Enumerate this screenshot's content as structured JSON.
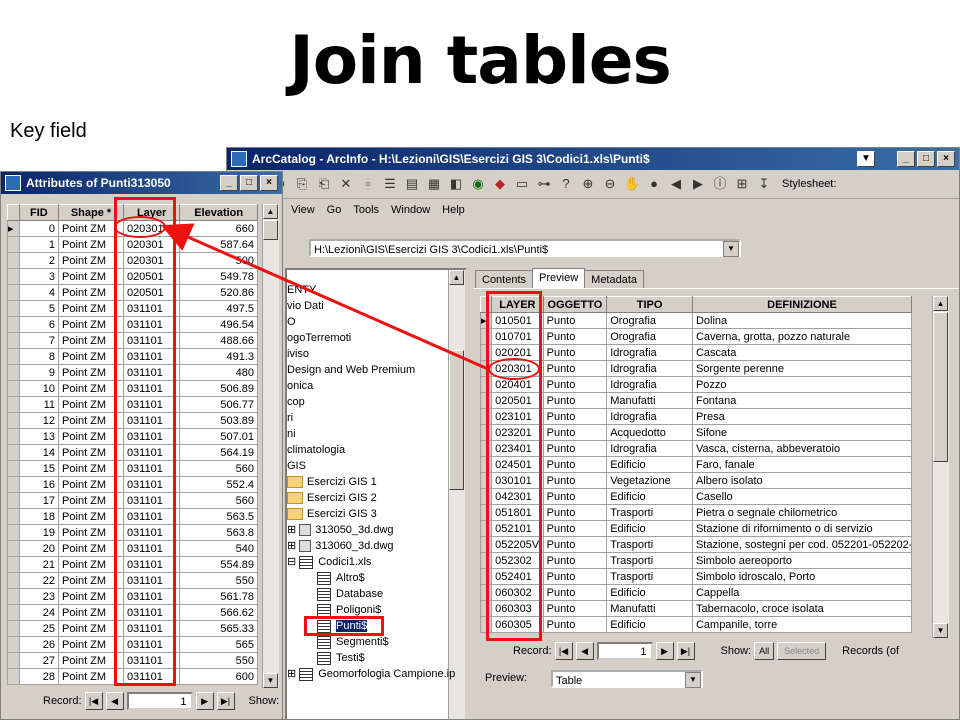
{
  "slide": {
    "title": "Join tables",
    "subtitle": "Key field"
  },
  "arccatalog": {
    "title": "ArcCatalog - ArcInfo - H:\\Lezioni\\GIS\\Esercizi GIS 3\\Codici1.xls\\Punti$",
    "menu": [
      "View",
      "Go",
      "Tools",
      "Window",
      "Help"
    ],
    "stylesheet_label": "Stylesheet:",
    "address": "H:\\Lezioni\\GIS\\Esercizi GIS 3\\Codici1.xls\\Punti$",
    "tree": [
      "ENTY",
      "vio Dati",
      "O",
      "ogoTerremoti",
      "iviso",
      "Design and Web Premium",
      "onica",
      "cop",
      "ri",
      "ni",
      "climatologia",
      "GIS",
      "Esercizi GIS 1",
      "Esercizi GIS 2",
      "Esercizi GIS 3",
      "313050_3d.dwg",
      "313060_3d.dwg",
      "Codici1.xls",
      "Altro$",
      "Database",
      "Poligoni$",
      "Punti$",
      "Segmenti$",
      "Testi$",
      "Geomorfologia Campione.ip"
    ],
    "tabs": [
      "Contents",
      "Preview",
      "Metadata"
    ],
    "active_tab": "Preview",
    "columns": [
      "LAYER",
      "OGGETTO",
      "TIPO",
      "DEFINIZIONE"
    ],
    "rows": [
      [
        "010501",
        "Punto",
        "Orografia",
        "Dolina"
      ],
      [
        "010701",
        "Punto",
        "Orografia",
        "Caverna, grotta, pozzo naturale"
      ],
      [
        "020201",
        "Punto",
        "Idrografia",
        "Cascata"
      ],
      [
        "020301",
        "Punto",
        "Idrografia",
        "Sorgente perenne"
      ],
      [
        "020401",
        "Punto",
        "Idrografia",
        "Pozzo"
      ],
      [
        "020501",
        "Punto",
        "Manufatti",
        "Fontana"
      ],
      [
        "023101",
        "Punto",
        "Idrografia",
        "Presa"
      ],
      [
        "023201",
        "Punto",
        "Acquedotto",
        "Sifone"
      ],
      [
        "023401",
        "Punto",
        "Idrografia",
        "Vasca, cisterna, abbeveratoio"
      ],
      [
        "024501",
        "Punto",
        "Edificio",
        "Faro, fanale"
      ],
      [
        "030101",
        "Punto",
        "Vegetazione",
        "Albero isolato"
      ],
      [
        "042301",
        "Punto",
        "Edificio",
        "Casello"
      ],
      [
        "051801",
        "Punto",
        "Trasporti",
        "Pietra o segnale chilometrico"
      ],
      [
        "052101",
        "Punto",
        "Edificio",
        "Stazione di rifornimento o di servizio"
      ],
      [
        "052205V",
        "Punto",
        "Trasporti",
        "Stazione, sostegni per cod. 052201-052202-"
      ],
      [
        "052302",
        "Punto",
        "Trasporti",
        "Simbolo aereoporto"
      ],
      [
        "052401",
        "Punto",
        "Trasporti",
        "Simbolo idroscalo, Porto"
      ],
      [
        "060302",
        "Punto",
        "Edificio",
        "Cappella"
      ],
      [
        "060303",
        "Punto",
        "Manufatti",
        "Tabernacolo, croce isolata"
      ],
      [
        "060305",
        "Punto",
        "Edificio",
        "Campanile, torre"
      ]
    ],
    "record_label": "Record:",
    "record_value": "1",
    "show_label": "Show:",
    "show_all": "All",
    "show_selected": "Selected",
    "records_label": "Records (of",
    "preview_label": "Preview:",
    "preview_value": "Table"
  },
  "attributes": {
    "title": "Attributes of Punti313050",
    "columns": [
      "FID",
      "Shape *",
      "Layer",
      "Elevation"
    ],
    "rows": [
      [
        "0",
        "Point ZM",
        "020301",
        "660"
      ],
      [
        "1",
        "Point ZM",
        "020301",
        "587.64"
      ],
      [
        "2",
        "Point ZM",
        "020301",
        "500"
      ],
      [
        "3",
        "Point ZM",
        "020501",
        "549.78"
      ],
      [
        "4",
        "Point ZM",
        "020501",
        "520.86"
      ],
      [
        "5",
        "Point ZM",
        "031101",
        "497.5"
      ],
      [
        "6",
        "Point ZM",
        "031101",
        "496.54"
      ],
      [
        "7",
        "Point ZM",
        "031101",
        "488.66"
      ],
      [
        "8",
        "Point ZM",
        "031101",
        "491.3"
      ],
      [
        "9",
        "Point ZM",
        "031101",
        "480"
      ],
      [
        "10",
        "Point ZM",
        "031101",
        "506.89"
      ],
      [
        "11",
        "Point ZM",
        "031101",
        "506.77"
      ],
      [
        "12",
        "Point ZM",
        "031101",
        "503.89"
      ],
      [
        "13",
        "Point ZM",
        "031101",
        "507.01"
      ],
      [
        "14",
        "Point ZM",
        "031101",
        "564.19"
      ],
      [
        "15",
        "Point ZM",
        "031101",
        "560"
      ],
      [
        "16",
        "Point ZM",
        "031101",
        "552.4"
      ],
      [
        "17",
        "Point ZM",
        "031101",
        "560"
      ],
      [
        "18",
        "Point ZM",
        "031101",
        "563.5"
      ],
      [
        "19",
        "Point ZM",
        "031101",
        "563.8"
      ],
      [
        "20",
        "Point ZM",
        "031101",
        "540"
      ],
      [
        "21",
        "Point ZM",
        "031101",
        "554.89"
      ],
      [
        "22",
        "Point ZM",
        "031101",
        "550"
      ],
      [
        "23",
        "Point ZM",
        "031101",
        "561.78"
      ],
      [
        "24",
        "Point ZM",
        "031101",
        "566.62"
      ],
      [
        "25",
        "Point ZM",
        "031101",
        "565.33"
      ],
      [
        "26",
        "Point ZM",
        "031101",
        "565"
      ],
      [
        "27",
        "Point ZM",
        "031101",
        "550"
      ],
      [
        "28",
        "Point ZM",
        "031101",
        "600"
      ]
    ],
    "record_label": "Record:",
    "record_value": "1",
    "show_label": "Show:"
  },
  "colors": {
    "highlight": "#ee1111",
    "titlebar": "#0a246a"
  }
}
